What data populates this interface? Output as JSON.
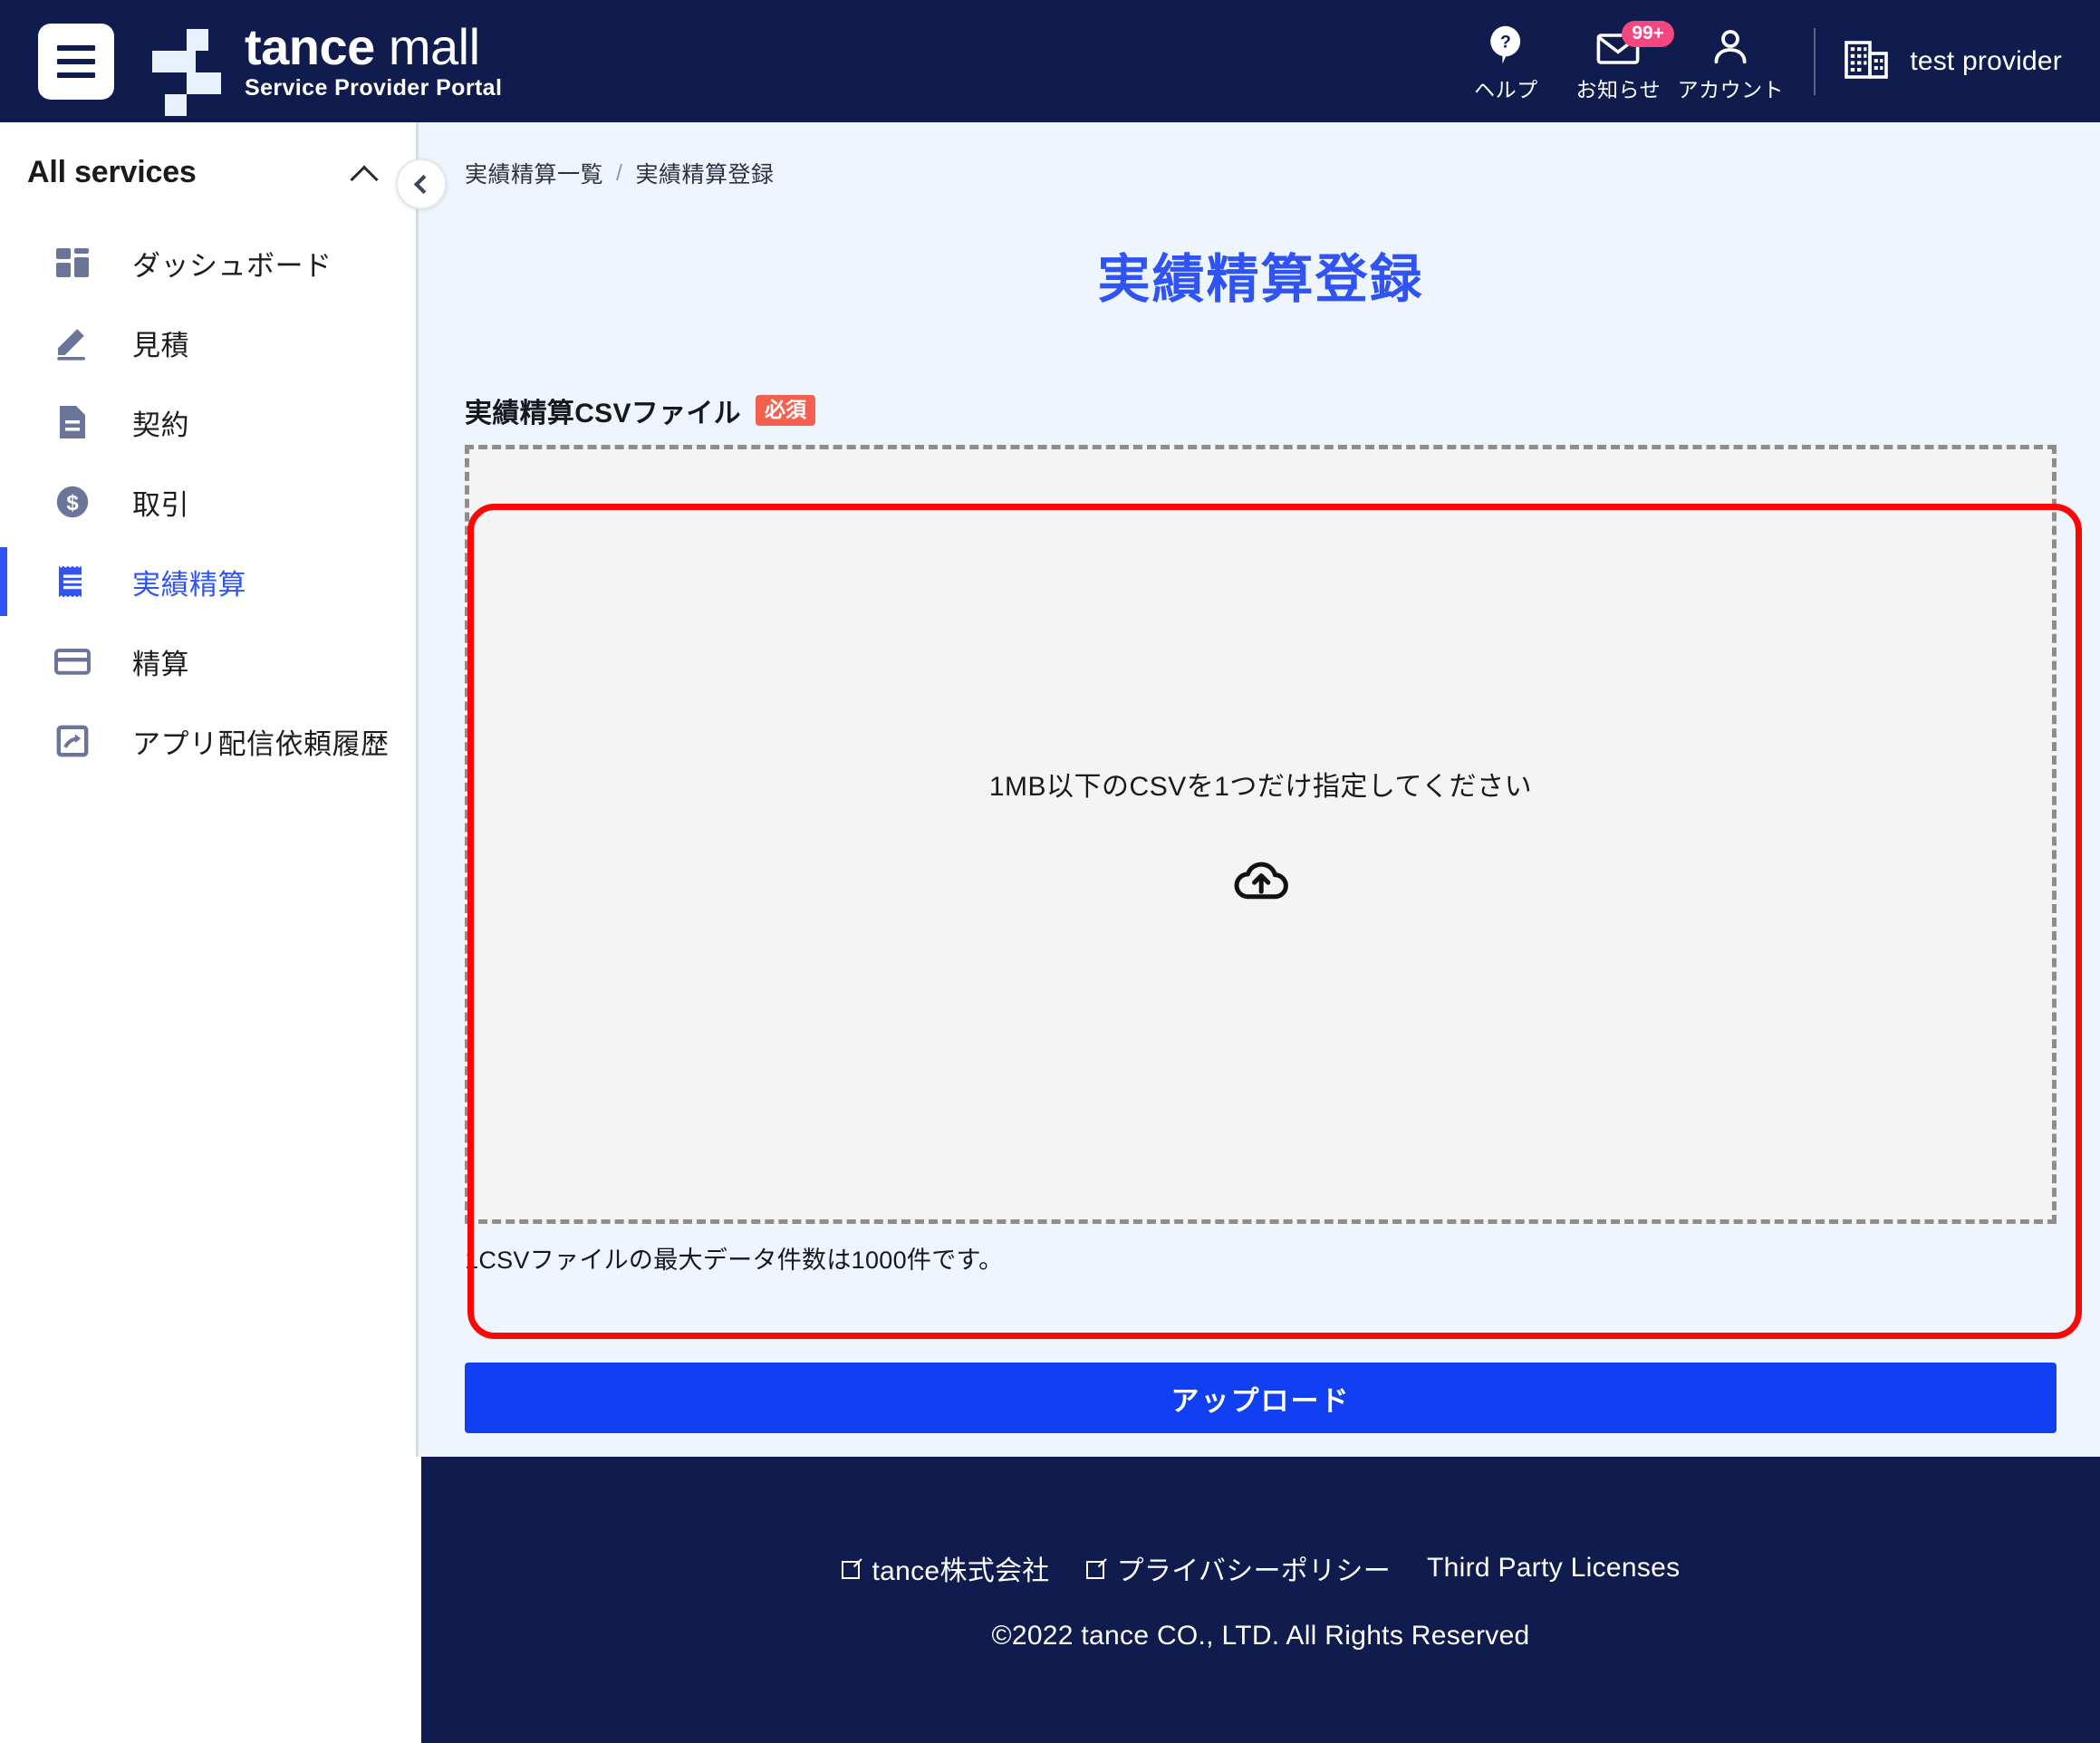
{
  "header": {
    "menu_icon": "hamburger-icon",
    "brand": {
      "name_bold": "tance",
      "name_thin": "mall",
      "subtitle": "Service Provider Portal"
    },
    "actions": [
      {
        "icon": "help-icon",
        "label": "ヘルプ",
        "badge": null
      },
      {
        "icon": "mail-icon",
        "label": "お知らせ",
        "badge": "99+"
      },
      {
        "icon": "person-icon",
        "label": "アカウント",
        "badge": null
      }
    ],
    "provider": {
      "icon": "building-icon",
      "name": "test provider"
    }
  },
  "sidebar": {
    "title": "All services",
    "collapse_chevron": "chevron-up-icon",
    "collapse_button_icon": "chevron-left-icon",
    "items": [
      {
        "label": "ダッシュボード",
        "icon": "dashboard-icon",
        "active": false
      },
      {
        "label": "見積",
        "icon": "pencil-icon",
        "active": false
      },
      {
        "label": "契約",
        "icon": "document-icon",
        "active": false
      },
      {
        "label": "取引",
        "icon": "dollar-circle-icon",
        "active": false
      },
      {
        "label": "実績精算",
        "icon": "receipt-icon",
        "active": true
      },
      {
        "label": "精算",
        "icon": "credit-card-icon",
        "active": false
      },
      {
        "label": "アプリ配信依頼履歴",
        "icon": "app-share-icon",
        "active": false
      }
    ]
  },
  "breadcrumb": {
    "parent": "実績精算一覧",
    "separator": "/",
    "current": "実績精算登録"
  },
  "main": {
    "page_title": "実績精算登録",
    "field": {
      "label": "実績精算CSVファイル",
      "required_badge": "必須",
      "dropzone_text": "1MB以下のCSVを1つだけ指定してください",
      "dropzone_icon": "cloud-upload-icon",
      "helper_text": "1CSVファイルの最大データ件数は1000件です。"
    },
    "submit_label": "アップロード"
  },
  "footer": {
    "links": [
      {
        "label": "tance株式会社",
        "external": true
      },
      {
        "label": "プライバシーポリシー",
        "external": true
      },
      {
        "label": "Third Party Licenses",
        "external": false
      }
    ],
    "copyright": "©2022 tance CO., LTD. All Rights Reserved"
  },
  "colors": {
    "header_bg": "#101c4e",
    "accent_blue": "#2f53f5",
    "button_blue": "#1140f2",
    "required_red": "#f4604f",
    "badge_pink": "#f4467f",
    "annotation_red": "#fb0707",
    "content_bg": "#eef5fd"
  }
}
